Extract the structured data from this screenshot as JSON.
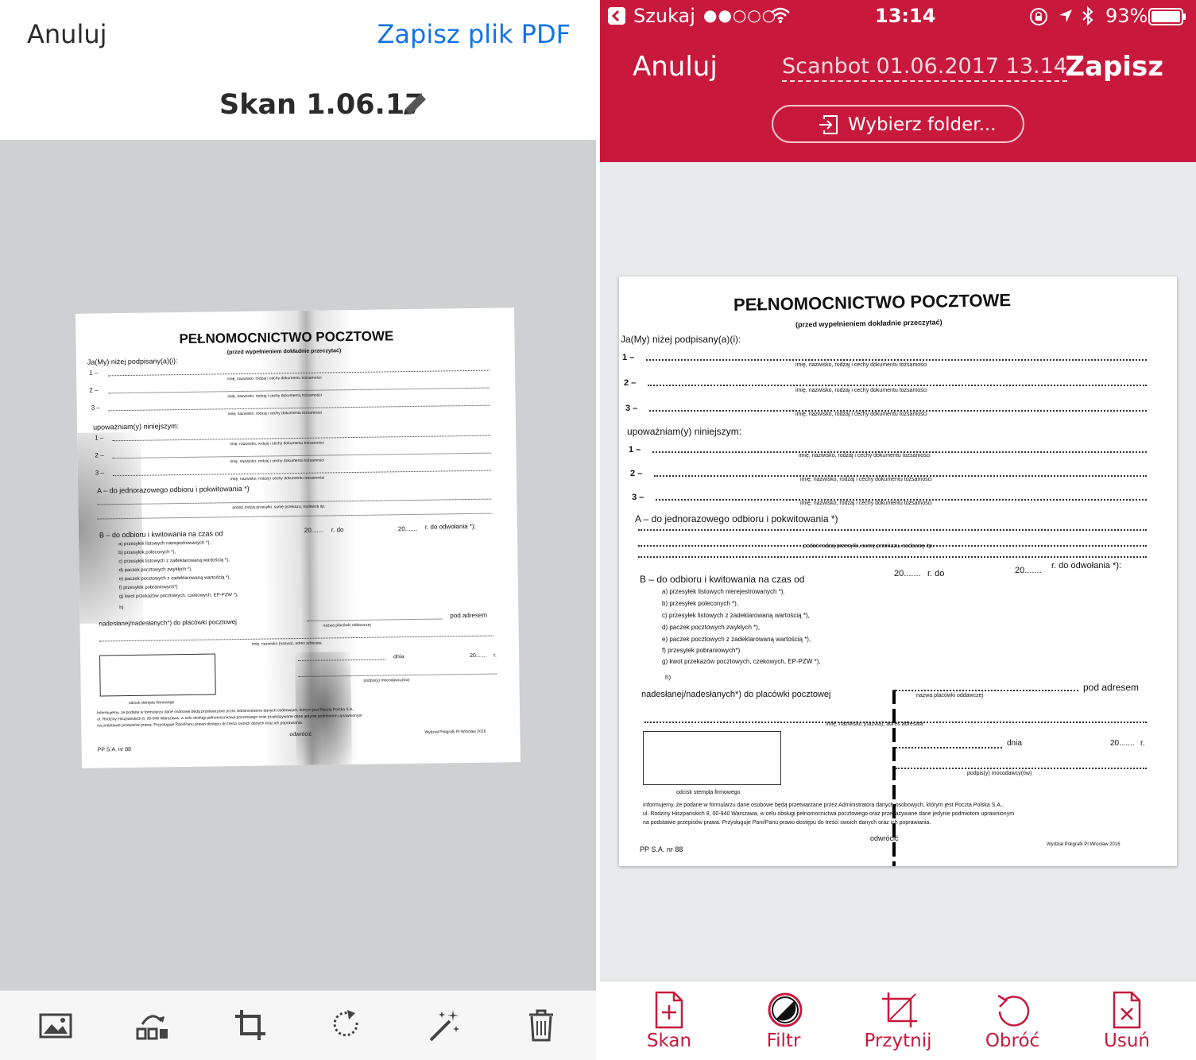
{
  "left_app": {
    "cancel_label": "Anuluj",
    "save_pdf_label": "Zapisz plik PDF",
    "document_title": "Skan 1.06.17",
    "toolbar": [
      {
        "name": "gallery-icon"
      },
      {
        "name": "reorder-icon"
      },
      {
        "name": "crop-icon"
      },
      {
        "name": "rotate-icon"
      },
      {
        "name": "magic-wand-icon"
      },
      {
        "name": "trash-icon"
      }
    ]
  },
  "right_app": {
    "status": {
      "carrier": "Szukaj",
      "signal": "●●○○○",
      "time": "13:14",
      "battery": "93%"
    },
    "nav": {
      "cancel_label": "Anuluj",
      "title": "Scanbot 01.06.2017 13.14",
      "save_label": "Zapisz"
    },
    "folder_button_label": "Wybierz folder...",
    "toolbar": [
      {
        "name": "scan-icon",
        "label": "Skan"
      },
      {
        "name": "filter-icon",
        "label": "Filtr"
      },
      {
        "name": "crop-icon",
        "label": "Przytnij"
      },
      {
        "name": "rotate-icon",
        "label": "Obróć"
      },
      {
        "name": "delete-icon",
        "label": "Usuń"
      }
    ],
    "accent_color": "#c8193c"
  },
  "doc": {
    "title": "PEŁNOMOCNICTWO POCZTOWE",
    "subtitle": "(przed wypełnieniem dokładnie przeczytać)",
    "intro": "Ja(My) niżej podpisany(a)(i):",
    "n1": "1 –",
    "n2": "2 –",
    "n3": "3 –",
    "id_hint": "imię, nazwisko, rodzaj i cechy dokumentu tożsamości",
    "authorize": "upoważniam(y) niniejszym:",
    "a_option": "A – do jednorazowego odbioru i pokwitowania *)",
    "a_hint": "podać rodzaj przesyłki, sumę przekazu, nadawcę itp.",
    "b_option": "B – do odbioru i kwitowania na czas od",
    "b_year1": "20.......",
    "b_to": "r. do",
    "b_year2": "20.......",
    "b_until": "r. do odwołania *):",
    "b_items": [
      "a) przesyłek listowych nierejestrowanych *),",
      "b) przesyłek poleconych *),",
      "c) przesyłek listowych z zadeklarowaną wartością *),",
      "d) paczek pocztowych zwykłych *),",
      "e) paczek pocztowych z zadeklarowaną wartością *),",
      "f) przesyłek pobraniowych*)",
      "g) kwot przekazów pocztowych, czekowych, EP-PZW *),",
      "h)"
    ],
    "delivered": "nadesłanej/nadesłanych*) do placówki pocztowej",
    "office_hint": "nazwa placówki oddawczej",
    "under_address": "pod adresem",
    "addressee_hint": "imię, nazwisko (nazwa), adres adresata",
    "day_label": "dnia",
    "year_label": "20.......",
    "r_label": "r.",
    "signature_hint": "podpis(y) mocodawcy(ów)",
    "stamp_hint": "odcisk stempla firmowego",
    "info_1": "Informujemy, że podane w formularzu dane osobowe będą przetwarzane przez Administratora danych osobowych, którym jest Poczta Polska S.A.,",
    "info_2": "ul. Rodziny Hiszpańskich 8, 00-940 Warszawa, w celu obsługi pełnomocnictwa pocztowego oraz przekazywane dane jedynie podmiotom uprawnionym",
    "info_3": "na podstawie przepisów prawa. Przysługuje Pani/Panu prawo dostępu do treści swoich danych oraz ich poprawiania.",
    "turn_over": "odwrócić",
    "form_no": "PP S.A. nr 88",
    "printer": "Wydział Poligrafii PI Wrocław 2016"
  }
}
